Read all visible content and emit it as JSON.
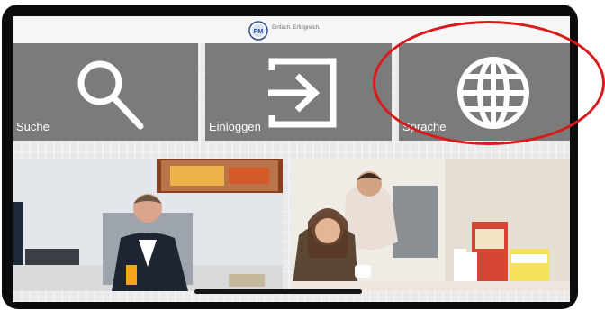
{
  "topbar": {
    "tagline": "Einfach. Erfolgreich.",
    "logo": "pm-logo"
  },
  "tiles": [
    {
      "label": "Suche",
      "icon": "search-icon"
    },
    {
      "label": "Einloggen",
      "icon": "login-icon"
    },
    {
      "label": "Sprache",
      "icon": "globe-icon"
    }
  ],
  "photos": [
    {
      "name": "office-portrait-photo"
    },
    {
      "name": "couple-products-photo"
    }
  ],
  "colors": {
    "tile": "#7b7b7b",
    "annotation": "#d81a1a",
    "background": "#e9e9e9"
  }
}
